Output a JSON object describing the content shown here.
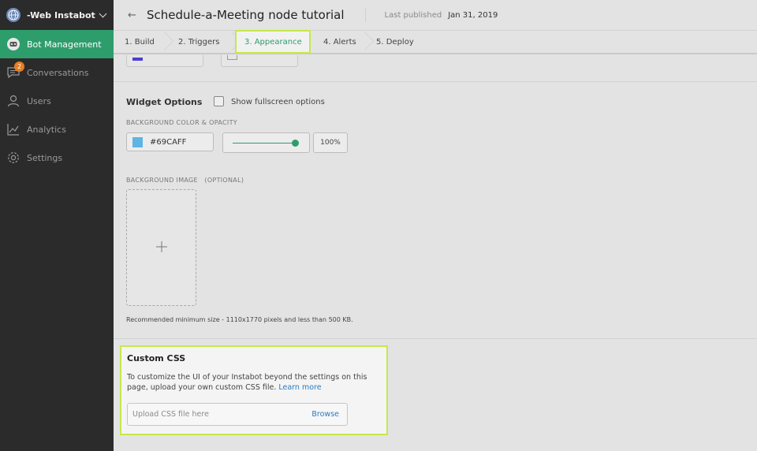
{
  "sidebar": {
    "workspace": "-Web Instabot",
    "items": [
      {
        "label": "Bot Management",
        "icon": "bot-icon",
        "active": true
      },
      {
        "label": "Conversations",
        "icon": "chat-icon",
        "badge": "2"
      },
      {
        "label": "Users",
        "icon": "user-icon"
      },
      {
        "label": "Analytics",
        "icon": "analytics-icon"
      },
      {
        "label": "Settings",
        "icon": "gear-icon"
      }
    ]
  },
  "header": {
    "title": "Schedule-a-Meeting node tutorial",
    "published_label": "Last published",
    "published_date": "Jan 31, 2019"
  },
  "steps": [
    {
      "label": "1. Build"
    },
    {
      "label": "2. Triggers"
    },
    {
      "label": "3. Appearance",
      "active": true
    },
    {
      "label": "4. Alerts"
    },
    {
      "label": "5. Deploy"
    }
  ],
  "widget": {
    "title": "Widget Options",
    "fullscreen_label": "Show fullscreen options",
    "bg_color_label": "BACKGROUND COLOR & OPACITY",
    "bg_color_value": "#69CAFF",
    "swatch_color": "#5db4e5",
    "opacity": 1.0,
    "opacity_text": "100%",
    "bg_image_label": "BACKGROUND IMAGE   (OPTIONAL)",
    "recommend_text": "Recommended minimum size - 1110x1770 pixels and less than 500 KB."
  },
  "custom_css": {
    "title": "Custom CSS",
    "description": "To customize the UI of your Instabot beyond the settings on this page, upload your own custom CSS file.",
    "link_text": "Learn more",
    "placeholder": "Upload CSS file here",
    "browse_label": "Browse"
  },
  "colors": {
    "accent": "#2e9d6c",
    "highlight": "#c6e84b",
    "link": "#2b7bbf"
  }
}
